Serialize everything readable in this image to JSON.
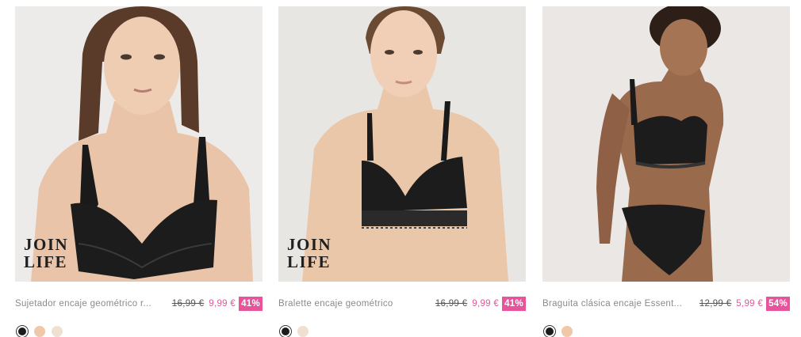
{
  "products": [
    {
      "name": "Sujetador encaje geométrico r...",
      "price_old": "16,99 €",
      "price_new": "9,99 €",
      "discount": "41%",
      "badge": [
        "JOIN",
        "LIFE"
      ],
      "swatches": [
        "black",
        "nude",
        "cream"
      ]
    },
    {
      "name": "Bralette encaje geométrico",
      "price_old": "16,99 €",
      "price_new": "9,99 €",
      "discount": "41%",
      "badge": [
        "JOIN",
        "LIFE"
      ],
      "swatches": [
        "black",
        "cream"
      ]
    },
    {
      "name": "Braguita clásica encaje Essent...",
      "price_old": "12,99 €",
      "price_new": "5,99 €",
      "discount": "54%",
      "swatches": [
        "black",
        "nude"
      ]
    }
  ],
  "colors": {
    "accent_pink": "#e8549b",
    "swatch_black": "#1b1b1b",
    "swatch_nude": "#f0c7a7",
    "swatch_cream": "#efe0d0"
  }
}
